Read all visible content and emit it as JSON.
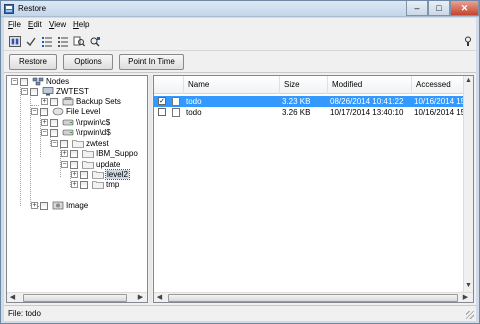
{
  "window": {
    "title": "Restore"
  },
  "menu": [
    {
      "key": "F",
      "rest": "ile"
    },
    {
      "key": "E",
      "rest": "dit"
    },
    {
      "key": "V",
      "rest": "iew"
    },
    {
      "key": "H",
      "rest": "elp"
    }
  ],
  "buttons": {
    "restore": "Restore",
    "options": "Options",
    "point_in_time": "Point In Time"
  },
  "tree": {
    "nodes": "Nodes",
    "zwtest_node": "ZWTEST",
    "backup_sets": "Backup Sets",
    "file_level": "File Level",
    "share_c": "\\\\rpwin\\c$",
    "share_d": "\\\\rpwin\\d$",
    "zwtest_dir": "zwtest",
    "ibm_support": "IBM_Suppo",
    "update": "update",
    "level2": "level2",
    "tmp": "tmp",
    "image": "Image"
  },
  "columns": {
    "name": "Name",
    "size": "Size",
    "modified": "Modified",
    "accessed": "Accessed"
  },
  "rows": [
    {
      "name": "todo",
      "size": "3.23 KB",
      "modified": "08/26/2014 10:41:22",
      "accessed": "10/16/2014 15:38",
      "checked": true,
      "selected": true
    },
    {
      "name": "todo",
      "size": "3.26 KB",
      "modified": "10/17/2014 13:40:10",
      "accessed": "10/16/2014 15:38",
      "checked": false,
      "selected": false
    }
  ],
  "status": "File: todo",
  "colors": {
    "selection": "#3399ff",
    "window_frame": "#cfdbe8"
  }
}
